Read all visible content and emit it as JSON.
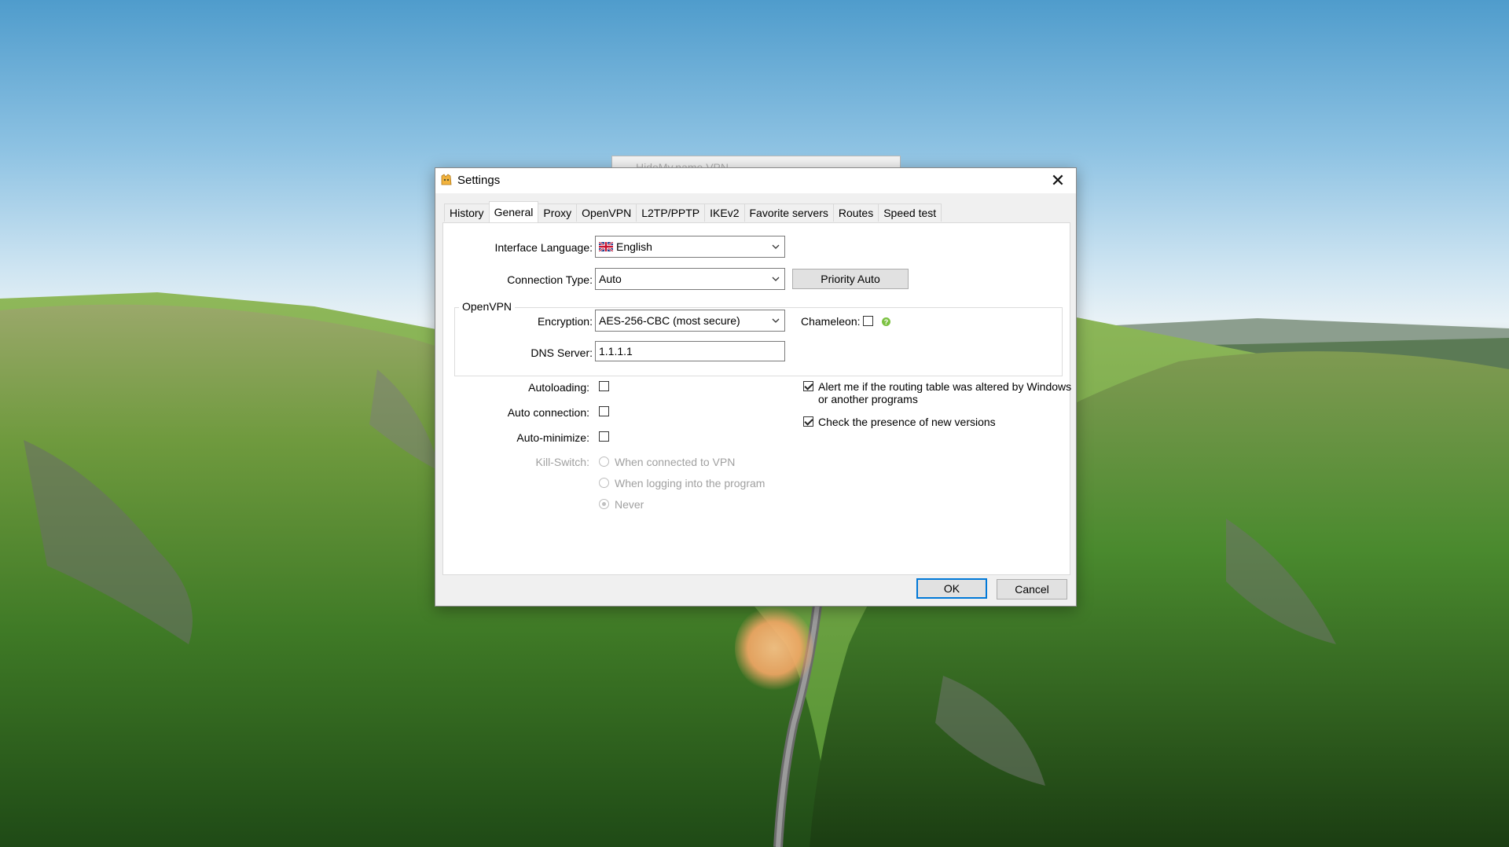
{
  "background_window": {
    "title": "HideMy.name VPN"
  },
  "dialog": {
    "title": "Settings",
    "close_glyph": "✕",
    "tabs": [
      "History",
      "General",
      "Proxy",
      "OpenVPN",
      "L2TP/PPTP",
      "IKEv2",
      "Favorite servers",
      "Routes",
      "Speed test"
    ],
    "active_tab": "General",
    "interface_language": {
      "label": "Interface Language:",
      "value": "English",
      "flag_icon": "uk-flag-icon"
    },
    "connection_type": {
      "label": "Connection Type:",
      "value": "Auto",
      "priority_button": "Priority Auto"
    },
    "openvpn_group": {
      "title": "OpenVPN",
      "encryption_label": "Encryption:",
      "encryption_value": "AES-256-CBC (most secure)",
      "chameleon_label": "Chameleon:",
      "chameleon_checked": false,
      "dns_label": "DNS Server:",
      "dns_value": "1.1.1.1"
    },
    "options": {
      "autoloading": {
        "label": "Autoloading:",
        "checked": false
      },
      "auto_connection": {
        "label": "Auto connection:",
        "checked": false
      },
      "auto_minimize": {
        "label": "Auto-minimize:",
        "checked": false
      },
      "alert_routing": {
        "line1": "Alert me if the routing table was altered by Windows",
        "line2": "or another programs",
        "checked": true
      },
      "check_versions": {
        "label": "Check the presence of new versions",
        "checked": true
      }
    },
    "kill_switch": {
      "label": "Kill-Switch:",
      "options": [
        "When connected to VPN",
        "When logging into the program",
        "Never"
      ],
      "selected": "Never",
      "disabled": true
    },
    "buttons": {
      "ok": "OK",
      "cancel": "Cancel"
    }
  },
  "colors": {
    "focus_border": "#0078d7",
    "help_icon": "#7cc242",
    "disabled_text": "#a0a0a0"
  }
}
